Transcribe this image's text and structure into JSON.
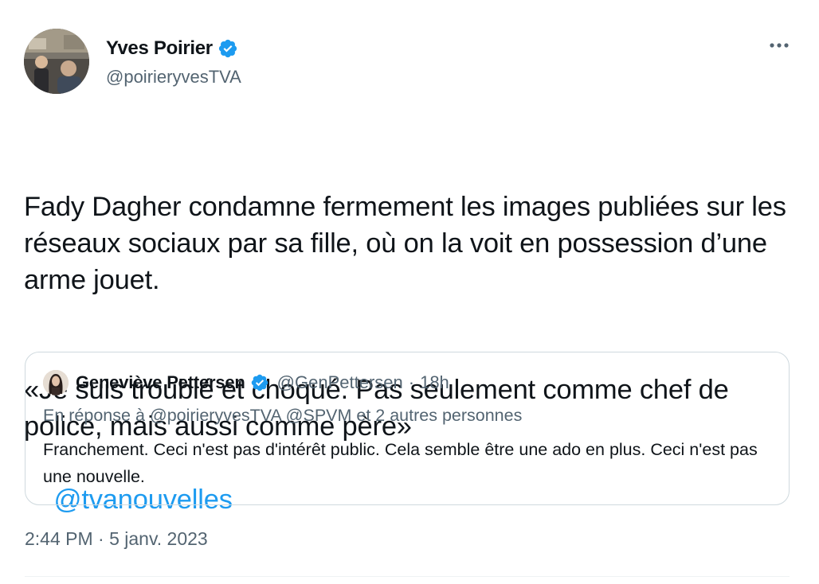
{
  "author": {
    "name": "Yves Poirier",
    "handle": "@poirieryvesTVA",
    "verified": true,
    "avatar_icon": "avatar-photo-icon"
  },
  "tweet": {
    "lines": [
      "Fady Dagher condamne fermement les images publiées sur les réseaux sociaux par sa fille, où on la voit en possession d’une arme jouet.",
      "«Je suis troublé et choqué. Pas seulement comme chef de police, mais aussi comme père»"
    ],
    "mention": "@tvanouvelles",
    "timestamp": "2:44 PM · 5 janv. 2023"
  },
  "quoted": {
    "name": "Geneviève Pettersen",
    "handle": "@GenPettersen",
    "separator": "·",
    "time": "18h",
    "verified": true,
    "reply_context": "En réponse à @poirieryvesTVA @SPVM  et 2 autres personnes",
    "text": "Franchement. Ceci n'est pas d'intérêt public. Cela semble être une ado en plus. Ceci n'est pas une nouvelle."
  },
  "colors": {
    "link": "#1d9bf0",
    "secondary_text": "#536471",
    "border": "#cfd9de",
    "verified_badge": "#1d9bf0"
  }
}
